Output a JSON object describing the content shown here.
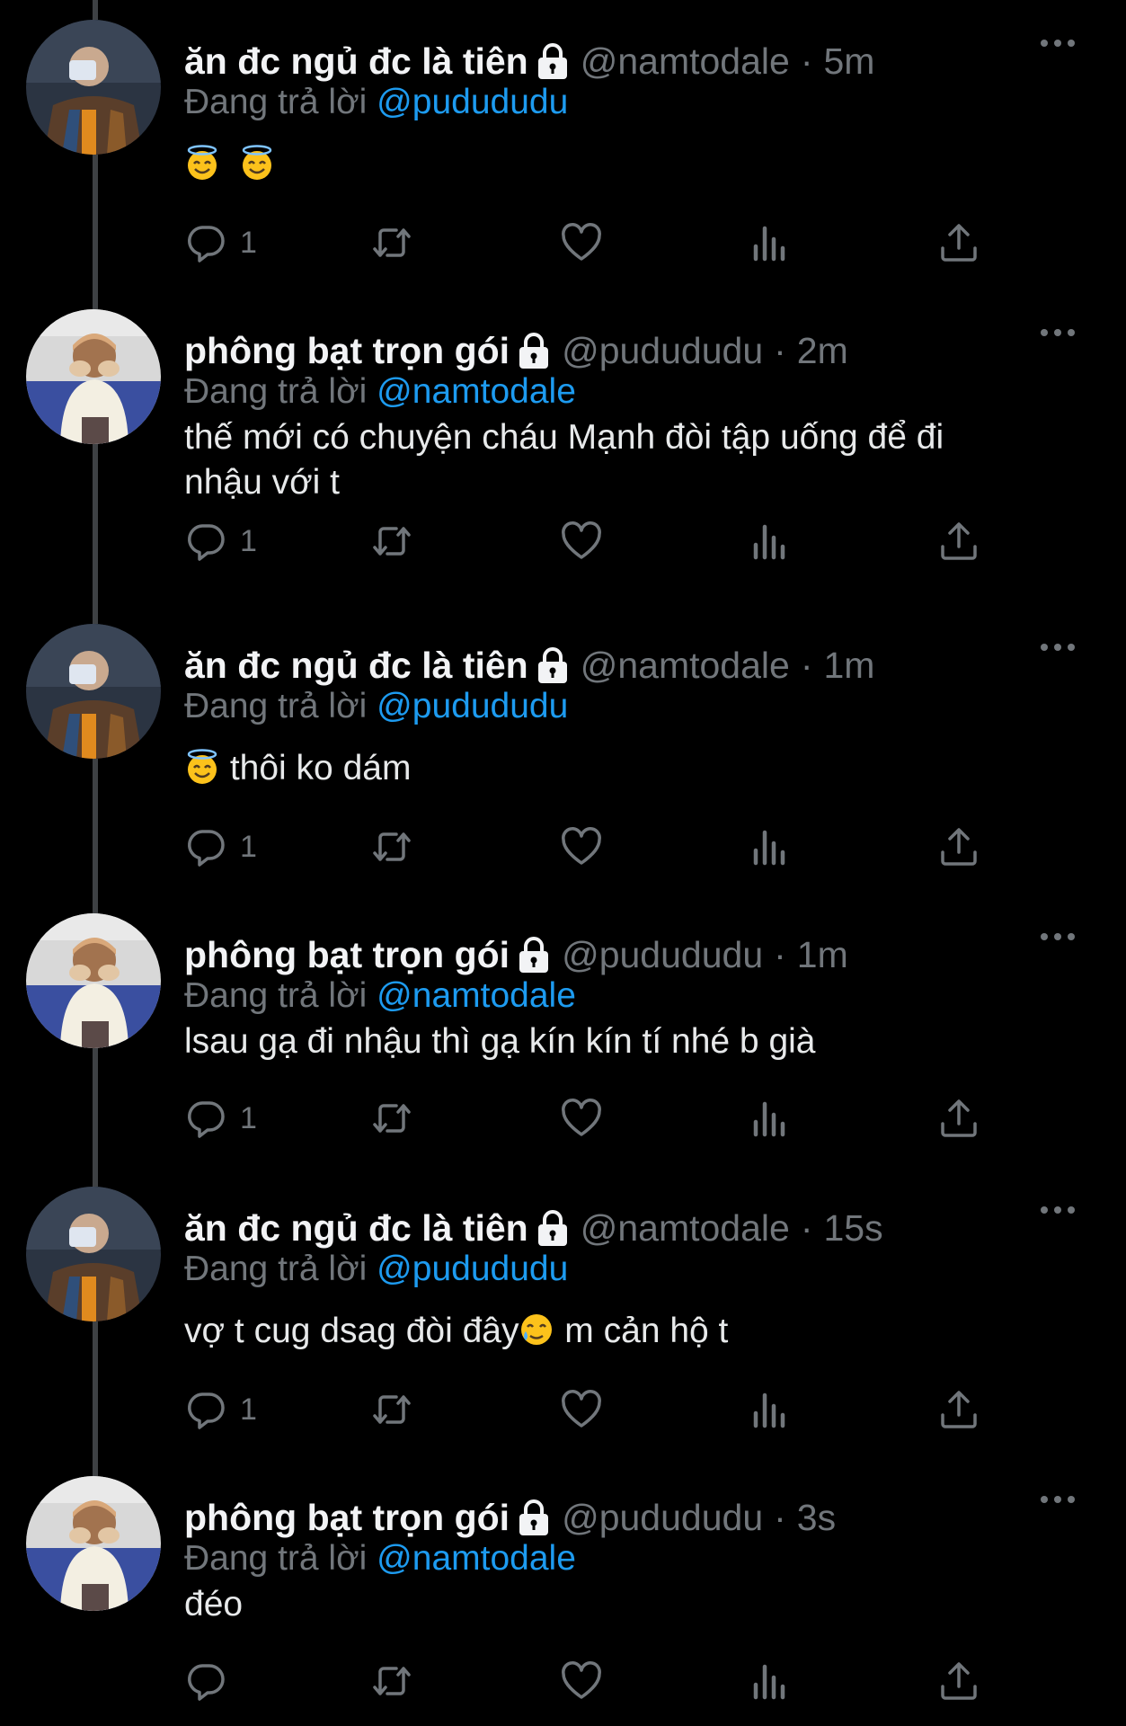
{
  "reply_prefix": "Đang trả lời",
  "tweets": [
    {
      "name": "ăn đc ngủ đc là tiên",
      "handle": "@namtodale",
      "separator": "·",
      "time": "5m",
      "reply_to": "@pudududu",
      "text_parts": [
        "",
        ""
      ],
      "emoji_before": [
        "smiling-face-with-halo",
        "smiling-face-with-halo"
      ],
      "reply_count": "1",
      "avatar": "avatar-namtodale"
    },
    {
      "name": "phông bạt trọn gói",
      "handle": "@pudududu",
      "separator": "·",
      "time": "2m",
      "reply_to": "@namtodale",
      "text_line1": "thế mới có chuyện cháu Mạnh đòi tập uống để đi",
      "text_line2": "nhậu với t",
      "reply_count": "1",
      "avatar": "avatar-pudududu"
    },
    {
      "name": "ăn đc ngủ đc là tiên",
      "handle": "@namtodale",
      "separator": "·",
      "time": "1m",
      "reply_to": "@pudududu",
      "text": "thôi ko dám",
      "emoji": "smiling-face-with-halo",
      "reply_count": "1",
      "avatar": "avatar-namtodale"
    },
    {
      "name": "phông bạt trọn gói",
      "handle": "@pudududu",
      "separator": "·",
      "time": "1m",
      "reply_to": "@namtodale",
      "text": "lsau gạ đi nhậu thì gạ kín kín tí nhé b già",
      "reply_count": "1",
      "avatar": "avatar-pudududu"
    },
    {
      "name": "ăn đc ngủ đc là tiên",
      "handle": "@namtodale",
      "separator": "·",
      "time": "15s",
      "reply_to": "@pudududu",
      "text_before": "vợ t cug dsag đòi đây",
      "text_after": " m cản hộ t",
      "emoji": "smiling-face-with-tear",
      "reply_count": "1",
      "avatar": "avatar-namtodale"
    },
    {
      "name": "phông bạt trọn gói",
      "handle": "@pudududu",
      "separator": "·",
      "time": "3s",
      "reply_to": "@namtodale",
      "text": "đéo",
      "reply_count": "",
      "avatar": "avatar-pudududu"
    }
  ],
  "icons": {
    "lock": "lock-icon",
    "more": "more-icon",
    "reply": "reply-icon",
    "retweet": "retweet-icon",
    "like": "like-icon",
    "views": "views-icon",
    "share": "share-icon"
  },
  "colors": {
    "background": "#000000",
    "text": "#e7e9ea",
    "secondary": "#71767b",
    "mention": "#1d9bf0",
    "thread_line": "#3e4144"
  }
}
